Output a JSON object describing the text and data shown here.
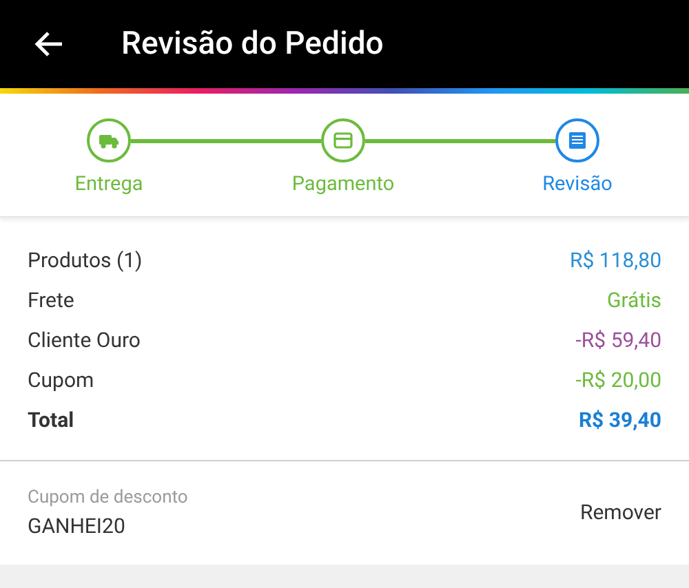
{
  "header": {
    "title": "Revisão do Pedido"
  },
  "steps": [
    {
      "label": "Entrega",
      "kind": "truck",
      "selected": false
    },
    {
      "label": "Pagamento",
      "kind": "card",
      "selected": false
    },
    {
      "label": "Revisão",
      "kind": "document",
      "selected": true
    }
  ],
  "summary": [
    {
      "label": "Produtos (1)",
      "value": "R$ 118,80",
      "color": "#2a8fd6",
      "kind": "line"
    },
    {
      "label": "Frete",
      "value": "Grátis",
      "color": "#6cbb3c",
      "kind": "line"
    },
    {
      "label": "Cliente Ouro",
      "value": "-R$ 59,40",
      "color": "#9b4f9b",
      "kind": "line"
    },
    {
      "label": "Cupom",
      "value": "-R$ 20,00",
      "color": "#6cbb3c",
      "kind": "line"
    },
    {
      "label": "Total",
      "value": "R$ 39,40",
      "color": "#1a7fd4",
      "kind": "total"
    }
  ],
  "coupon": {
    "label": "Cupom de desconto",
    "code": "GANHEI20",
    "action": "Remover"
  }
}
